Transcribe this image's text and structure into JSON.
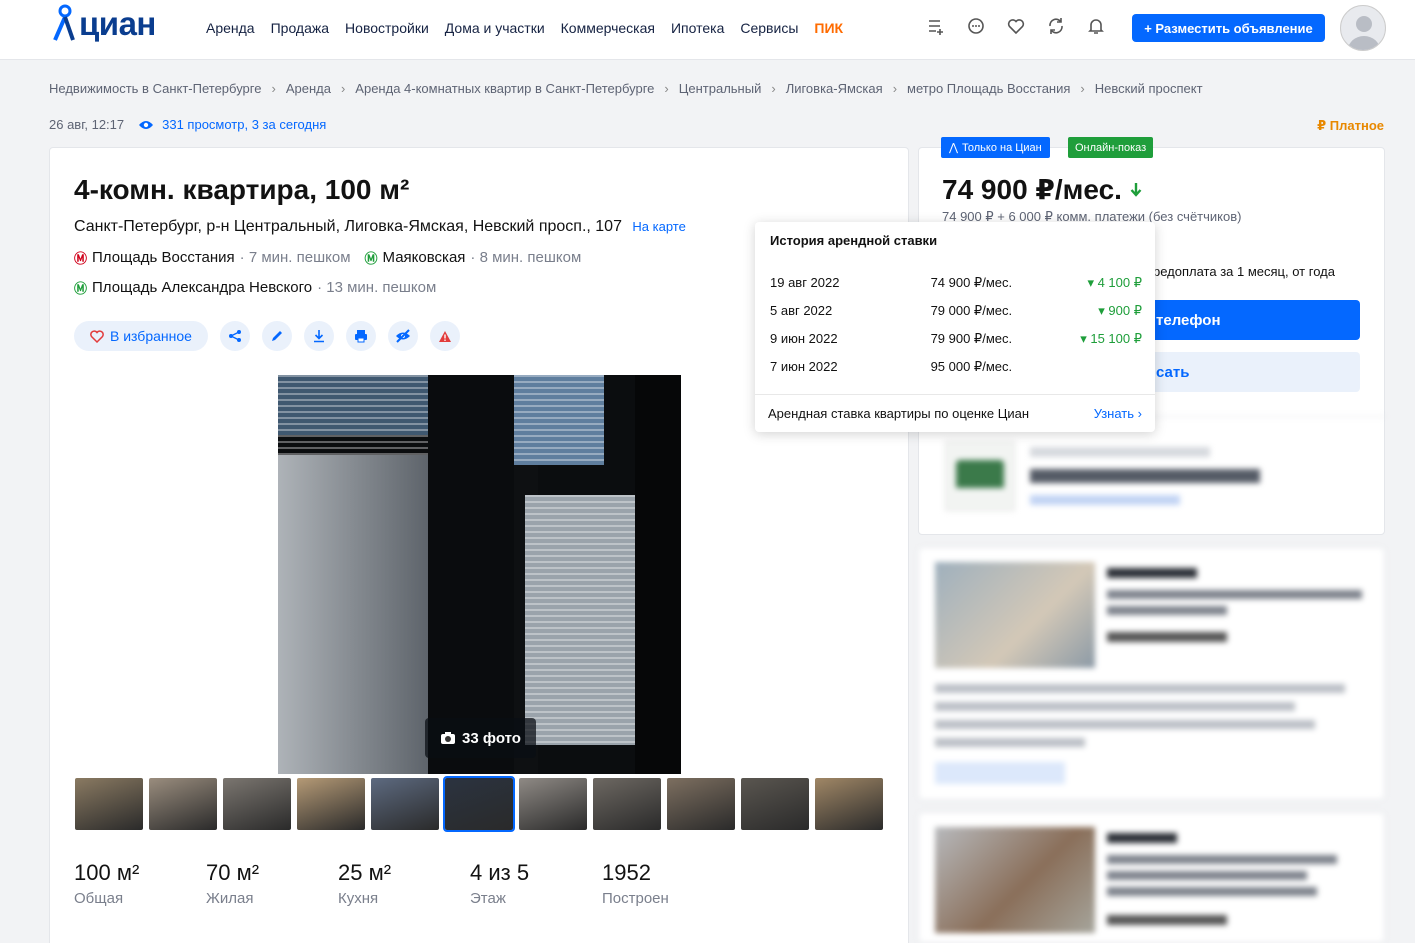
{
  "header": {
    "logo": "циан",
    "nav": [
      "Аренда",
      "Продажа",
      "Новостройки",
      "Дома и участки",
      "Коммерческая",
      "Ипотека",
      "Сервисы"
    ],
    "pik": "ПИК",
    "post_button": "+ Разместить объявление"
  },
  "breadcrumb": [
    "Недвижимость в Санкт-Петербурге",
    "Аренда",
    "Аренда 4-комнатных квартир в Санкт-Петербурге",
    "Центральный",
    "Лиговка-Ямская",
    "метро Площадь Восстания",
    "Невский проспект"
  ],
  "meta": {
    "date": "26 авг, 12:17",
    "views": "331 просмотр, 3 за сегодня",
    "paid": "Платное"
  },
  "listing": {
    "title": "4-комн. квартира, 100 м²",
    "address": "Санкт-Петербург, р-н Центральный, Лиговка-Ямская, Невский просп., 107",
    "map_link": "На карте",
    "metro": [
      {
        "name": "Площадь Восстания",
        "walk": "· 7 мин. пешком",
        "line": "red"
      },
      {
        "name": "Маяковская",
        "walk": "· 8 мин. пешком",
        "line": "green"
      },
      {
        "name": "Площадь Александра Невского",
        "walk": "· 13 мин. пешком",
        "line": "green"
      }
    ],
    "favorite": "В избранное",
    "photo_count": "33 фото",
    "facts": [
      {
        "value": "100 м²",
        "label": "Общая"
      },
      {
        "value": "70 м²",
        "label": "Жилая"
      },
      {
        "value": "25 м²",
        "label": "Кухня"
      },
      {
        "value": "4 из 5",
        "label": "Этаж"
      },
      {
        "value": "1952",
        "label": "Построен"
      }
    ]
  },
  "thumb_colors": [
    "#8a7a62",
    "#9a8d7e",
    "#7b7670",
    "#b59a76",
    "#5d6a80",
    "#2b3340",
    "#8f8a85",
    "#6d6862",
    "#7d6f60",
    "#5a5650",
    "#a08766"
  ],
  "price_card": {
    "badge_cian": "Только на Циан",
    "badge_online": "Онлайн-показ",
    "price": "74 900 ₽/мес.",
    "price_sub": "74 900 ₽ + 6 000 ₽ комм. платежи (без счётчиков)",
    "prepay": "редоплата за 1 месяц, от года",
    "phone": "телефон",
    "write": "сать"
  },
  "history": {
    "title": "История арендной ставки",
    "rows": [
      {
        "date": "19 авг 2022",
        "price": "74 900 ₽/мес.",
        "change": "4 100 ₽"
      },
      {
        "date": "5 авг 2022",
        "price": "79 000 ₽/мес.",
        "change": "900 ₽"
      },
      {
        "date": "9 июн 2022",
        "price": "79 900 ₽/мес.",
        "change": "15 100 ₽"
      },
      {
        "date": "7 июн 2022",
        "price": "95 000 ₽/мес.",
        "change": ""
      }
    ],
    "footer": "Арендная ставка квартиры по оценке Циан",
    "footer_link": "Узнать"
  }
}
